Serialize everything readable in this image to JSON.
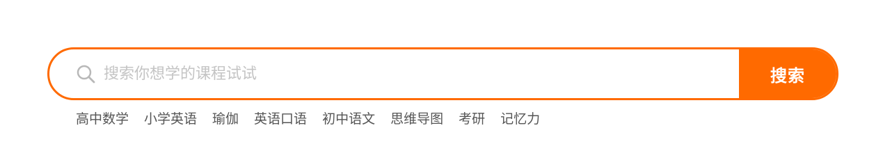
{
  "search": {
    "placeholder": "搜索你想学的课程试试",
    "value": "",
    "button_label": "搜索",
    "icon": "search-icon",
    "accent_color": "#ff6a00"
  },
  "hot_keywords": [
    "高中数学",
    "小学英语",
    "瑜伽",
    "英语口语",
    "初中语文",
    "思维导图",
    "考研",
    "记忆力"
  ]
}
